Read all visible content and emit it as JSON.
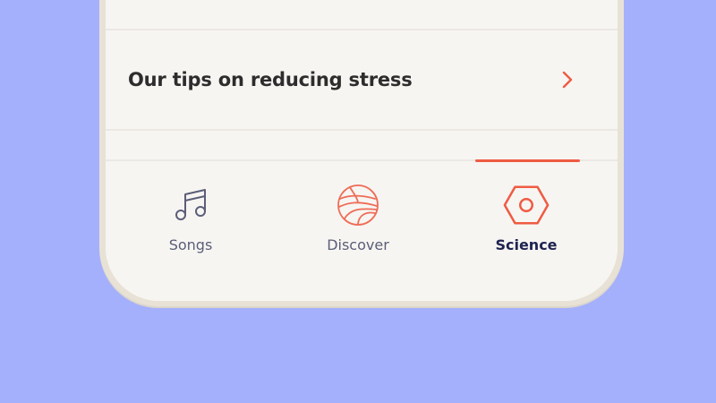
{
  "content": {
    "row_label": "Our tips on reducing stress",
    "row_chevron_icon": "chevron-right-icon"
  },
  "tabbar": {
    "accent_color": "#ef5b43",
    "tabs": [
      {
        "label": "Songs",
        "icon": "music-note-icon",
        "active": false
      },
      {
        "label": "Discover",
        "icon": "globe-icon",
        "active": false
      },
      {
        "label": "Science",
        "icon": "hexagon-icon",
        "active": true
      }
    ]
  },
  "colors": {
    "background": "#a4b0fc",
    "screen": "#f7f5f2",
    "text_dark": "#2e2c2c",
    "tab_inactive": "#5b5e78",
    "tab_active": "#1e2350"
  }
}
